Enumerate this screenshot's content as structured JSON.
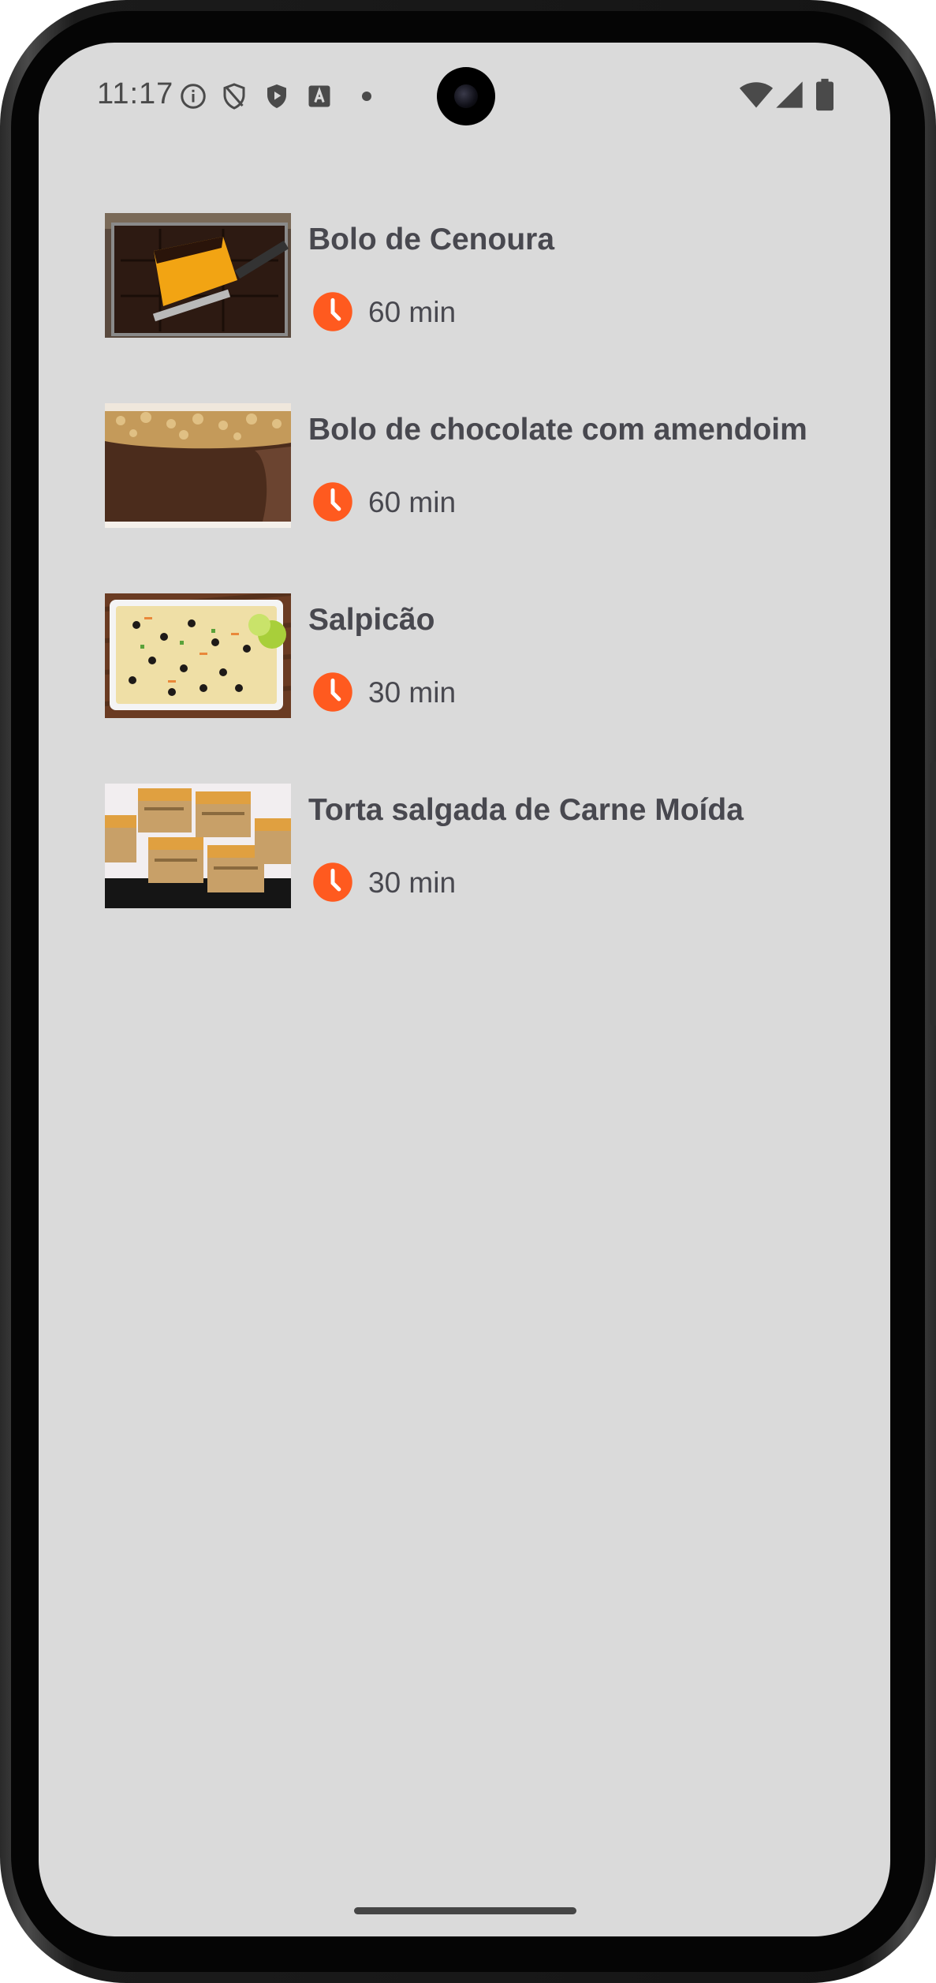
{
  "status_bar": {
    "time": "11:17",
    "left_icons": [
      "info-icon",
      "shield-icon",
      "play-protect-icon",
      "font-icon",
      "dot-icon"
    ],
    "right_icons": [
      "wifi-icon",
      "signal-icon",
      "battery-icon"
    ]
  },
  "recipes": [
    {
      "title": "Bolo de Cenoura",
      "duration": "60 min",
      "image": "carrot-cake-image"
    },
    {
      "title": "Bolo de chocolate com amendoim",
      "duration": "60 min",
      "image": "chocolate-peanut-cake-image"
    },
    {
      "title": "Salpicão",
      "duration": "30 min",
      "image": "salpicao-image"
    },
    {
      "title": "Torta salgada de Carne Moída",
      "duration": "30 min",
      "image": "meat-pie-image"
    }
  ],
  "colors": {
    "accent": "#ff5a1f",
    "background": "#dadada",
    "text": "#48484f"
  }
}
